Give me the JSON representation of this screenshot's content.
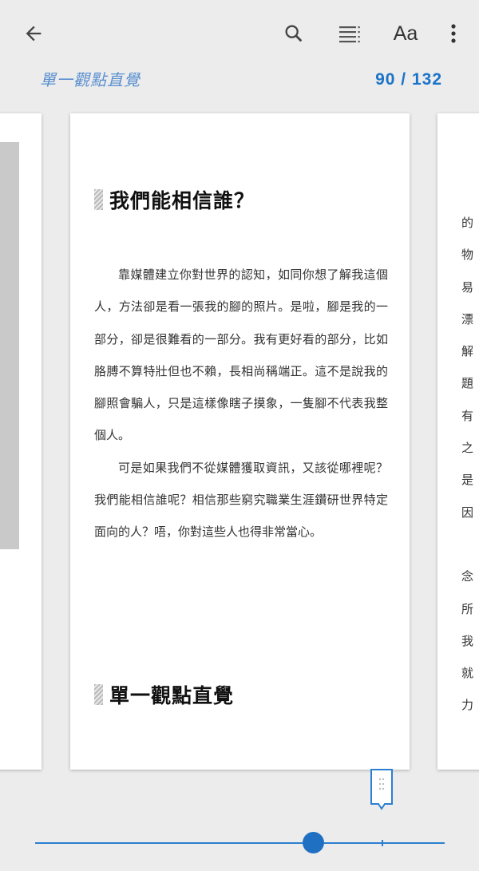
{
  "toolbar": {
    "back_icon": "arrow-left-icon",
    "search_icon": "search-icon",
    "toc_icon": "table-of-contents-icon",
    "font_label": "Aa",
    "more_icon": "more-vertical-icon"
  },
  "header": {
    "book_title": "單一觀點直覺",
    "page_indicator": "90 / 132"
  },
  "current_page": {
    "heading1": "我們能相信誰？",
    "paragraphs": [
      "靠媒體建立你對世界的認知，如同你想了解我這個人，方法卻是看一張我的腳的照片。是啦，腳是我的一部分，卻是很難看的一部分。我有更好看的部分，比如胳膊不算特壯但也不賴，長相尚稱端正。這不是說我的腳照會騙人，只是這樣像瞎子摸象，一隻腳不代表我整個人。",
      "可是如果我們不從媒體獲取資訊，又該從哪裡呢？我們能相信誰呢？相信那些窮究職業生涯鑽研世界特定面向的人？唔，你對這些人也得非常當心。"
    ],
    "heading2": "單一觀點直覺"
  },
  "next_page": {
    "line_fragments": [
      "的",
      "物",
      "易",
      "漂",
      "解",
      "題",
      "有",
      "之",
      "是",
      "因",
      "",
      "念",
      "所",
      "我",
      "就",
      "力"
    ]
  },
  "progress": {
    "current_page": 90,
    "total_pages": 132
  },
  "colors": {
    "accent": "#1f6fc3",
    "title": "#5a8fd0",
    "background": "#ececec"
  }
}
